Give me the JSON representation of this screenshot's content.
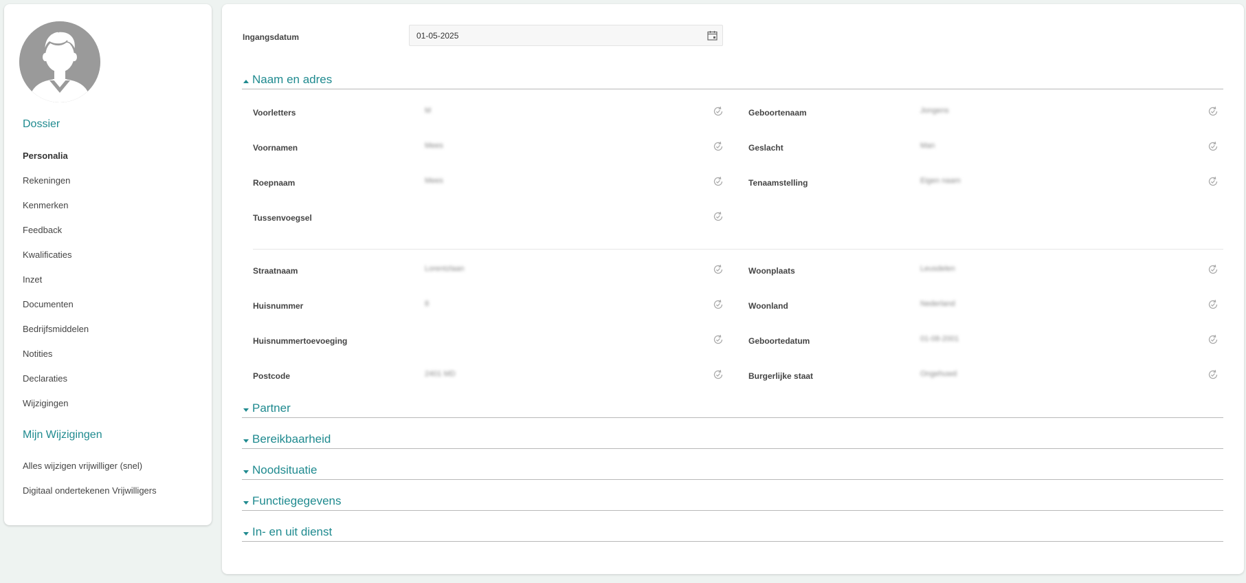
{
  "sidebar": {
    "dossier_heading": "Dossier",
    "items": [
      {
        "label": "Personalia",
        "active": true
      },
      {
        "label": "Rekeningen"
      },
      {
        "label": "Kenmerken"
      },
      {
        "label": "Feedback"
      },
      {
        "label": "Kwalificaties"
      },
      {
        "label": "Inzet"
      },
      {
        "label": "Documenten"
      },
      {
        "label": "Bedrijfsmiddelen"
      },
      {
        "label": "Notities"
      },
      {
        "label": "Declaraties"
      },
      {
        "label": "Wijzigingen"
      }
    ],
    "mijn_heading": "Mijn Wijzigingen",
    "mijn_items": [
      {
        "label": "Alles wijzigen vrijwilliger (snel)"
      },
      {
        "label": "Digitaal ondertekenen Vrijwilligers"
      }
    ]
  },
  "main": {
    "ingangsdatum_label": "Ingangsdatum",
    "ingangsdatum_value": "01-05-2025",
    "sections": [
      {
        "title": "Naam en adres",
        "expanded": true
      },
      {
        "title": "Partner",
        "expanded": false
      },
      {
        "title": "Bereikbaarheid",
        "expanded": false
      },
      {
        "title": "Noodsituatie",
        "expanded": false
      },
      {
        "title": "Functiegegevens",
        "expanded": false
      },
      {
        "title": "In- en uit dienst",
        "expanded": false
      }
    ],
    "fields_left_name": [
      {
        "label": "Voorletters",
        "value": "M"
      },
      {
        "label": "Voornamen",
        "value": "Mees"
      },
      {
        "label": "Roepnaam",
        "value": "Mees"
      },
      {
        "label": "Tussenvoegsel",
        "value": ""
      }
    ],
    "fields_right_name": [
      {
        "label": "Geboortenaam",
        "value": "Jongens"
      },
      {
        "label": "Geslacht",
        "value": "Man"
      },
      {
        "label": "Tenaamstelling",
        "value": "Eigen naam"
      }
    ],
    "fields_left_address": [
      {
        "label": "Straatnaam",
        "value": "Lorentzlaan"
      },
      {
        "label": "Huisnummer",
        "value": "8"
      },
      {
        "label": "Huisnummertoevoeging",
        "value": ""
      },
      {
        "label": "Postcode",
        "value": "2401 MD"
      }
    ],
    "fields_right_address": [
      {
        "label": "Woonplaats",
        "value": "Leusdelen"
      },
      {
        "label": "Woonland",
        "value": "Nederland"
      },
      {
        "label": "Geboortedatum",
        "value": "01-08-2001"
      },
      {
        "label": "Burgerlijke staat",
        "value": "Ongehuwd"
      }
    ]
  },
  "colors": {
    "accent": "#1f8a8f",
    "background": "#eef3f1",
    "avatar": "#9a9a9a"
  },
  "icons": {
    "avatar": "user-avatar-icon",
    "date": "calendar-icon",
    "history": "history-icon",
    "caret_up": "caret-up-icon",
    "caret_down": "caret-down-icon"
  }
}
